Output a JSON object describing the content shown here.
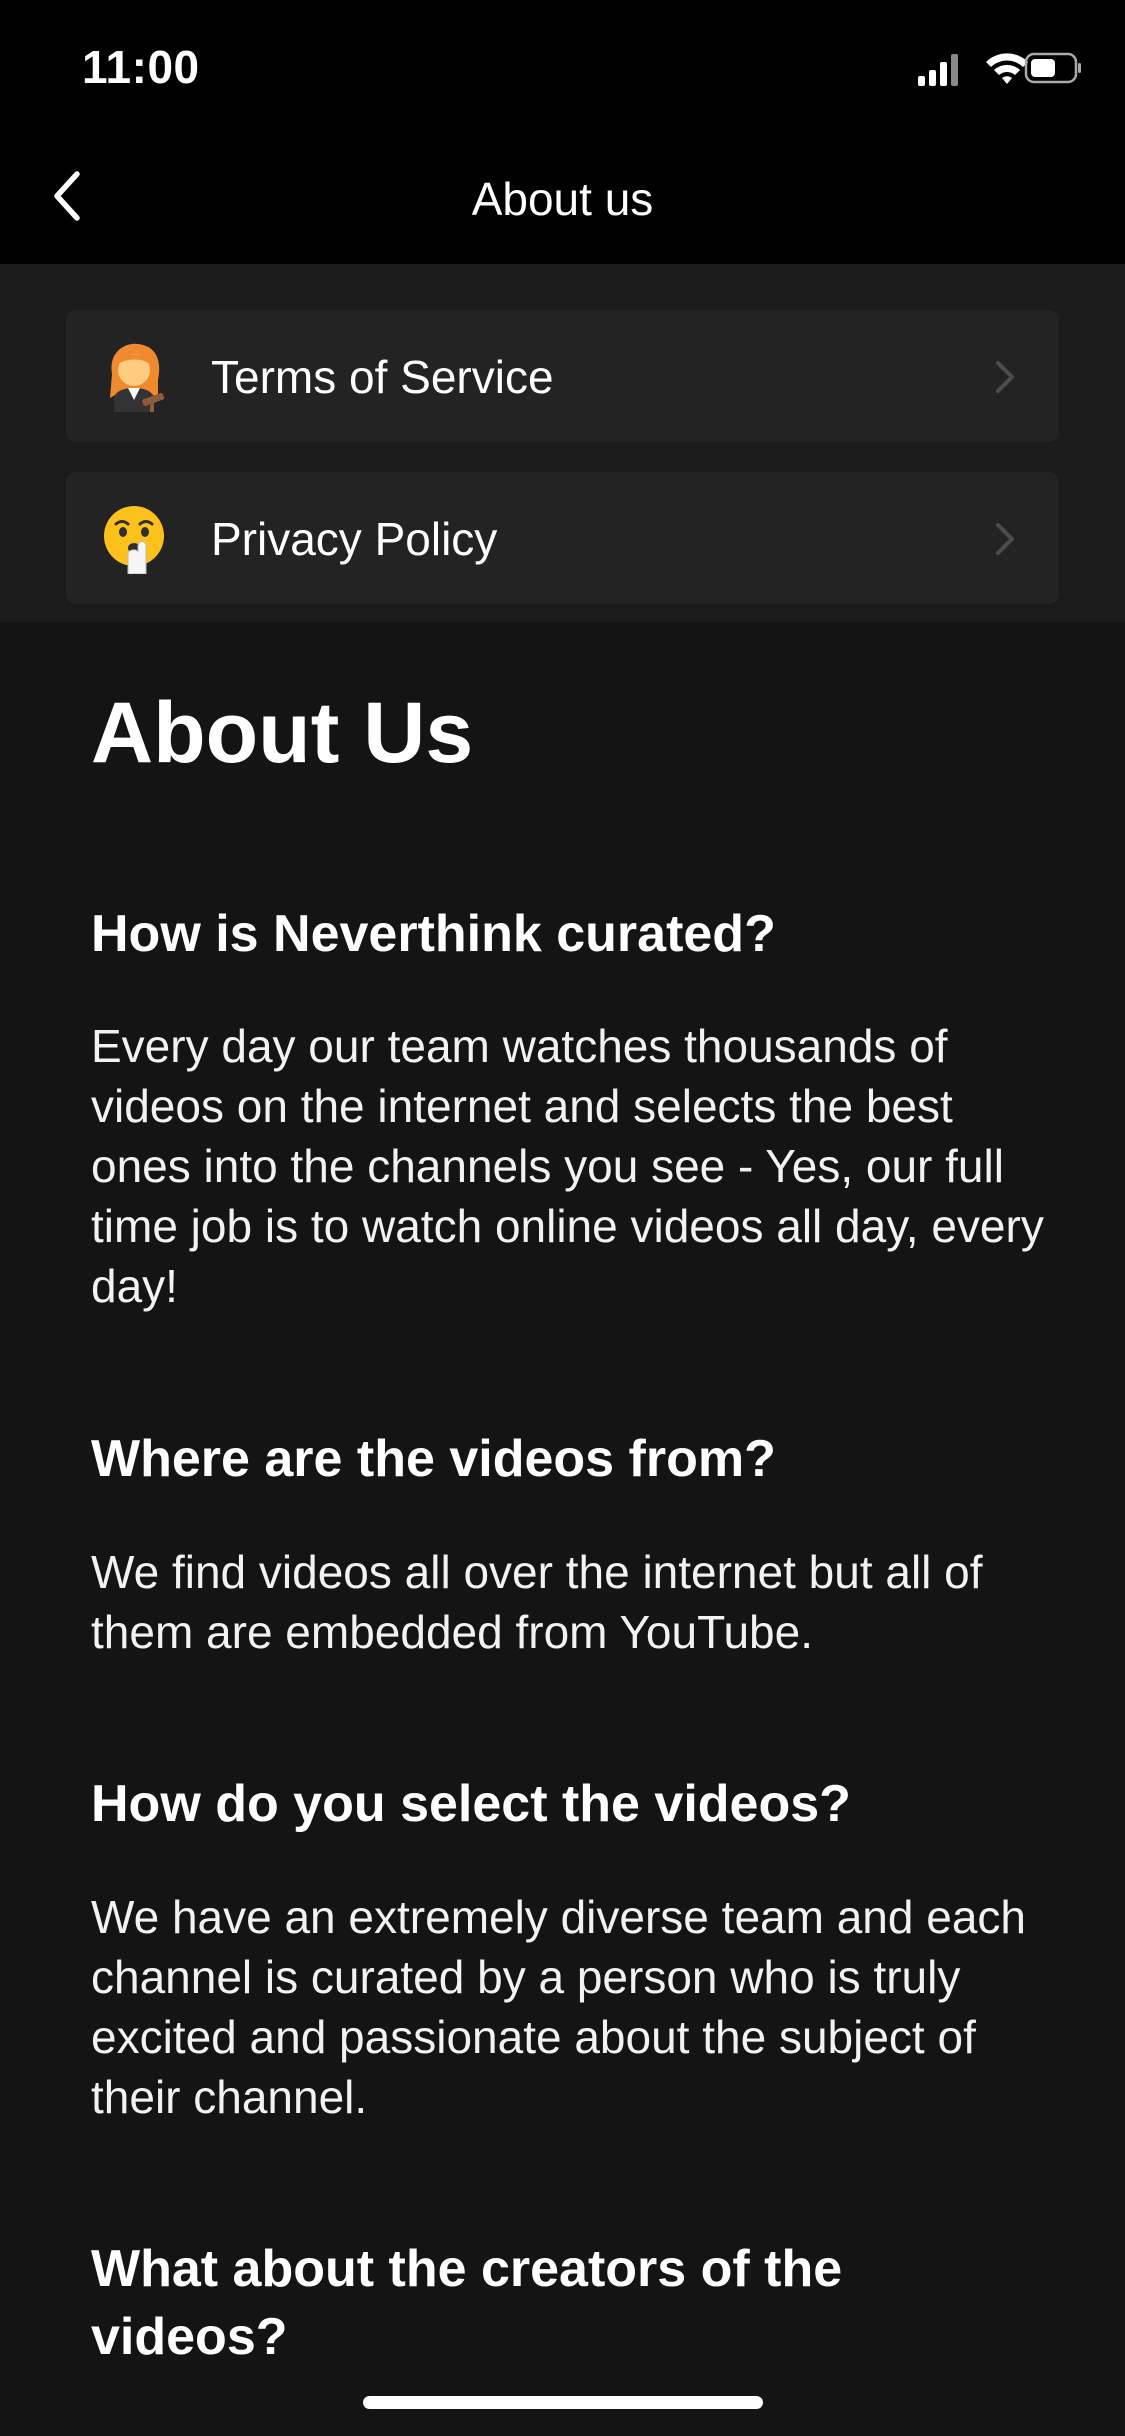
{
  "status_bar": {
    "time": "11:00",
    "icons": [
      "cellular-signal-icon",
      "wifi-icon",
      "battery-icon"
    ]
  },
  "nav": {
    "title": "About us",
    "back_icon": "chevron-left-icon"
  },
  "links": [
    {
      "label": "Terms of Service",
      "icon": "judge-woman-emoji"
    },
    {
      "label": "Privacy Policy",
      "icon": "shushing-face-emoji"
    }
  ],
  "content": {
    "heading": "About Us",
    "sections": [
      {
        "question": "How is Neverthink curated?",
        "answer": "Every day our team watches thousands of videos on the internet and selects the best ones into the channels you see - Yes, our full time job is to watch online videos all day, every day!"
      },
      {
        "question": "Where are the videos from?",
        "answer": "We find videos all over the internet but all of them are embedded from YouTube."
      },
      {
        "question": "How do you select the videos?",
        "answer": "We have an extremely diverse team and each channel is curated by a person who is truly excited and passionate about the subject of their channel."
      },
      {
        "question": "What about the creators of the videos?",
        "answer": ""
      }
    ]
  },
  "colors": {
    "background": "#141414",
    "bar_background": "#000000",
    "link_row_background": "#232323",
    "text": "#ffffff"
  }
}
